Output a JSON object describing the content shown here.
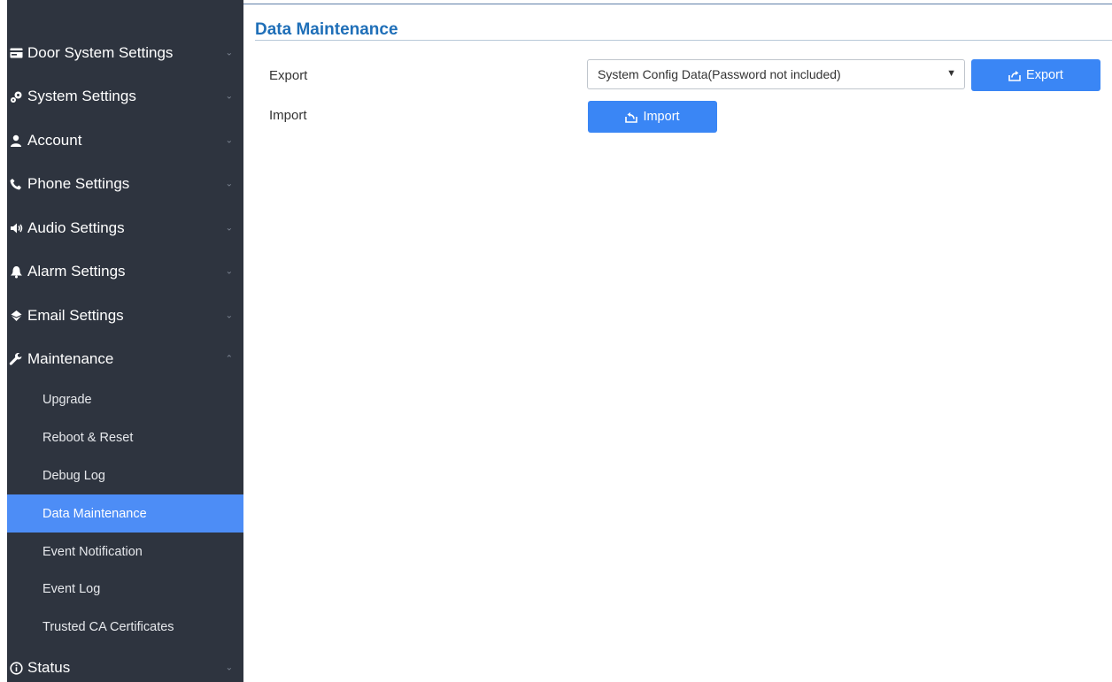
{
  "sidebar": {
    "items": [
      {
        "label": "Door System Settings",
        "icon": "card-icon"
      },
      {
        "label": "System Settings",
        "icon": "gears-icon"
      },
      {
        "label": "Account",
        "icon": "user-icon"
      },
      {
        "label": "Phone Settings",
        "icon": "phone-icon"
      },
      {
        "label": "Audio Settings",
        "icon": "speaker-icon"
      },
      {
        "label": "Alarm Settings",
        "icon": "bell-icon"
      },
      {
        "label": "Email Settings",
        "icon": "email-icon"
      },
      {
        "label": "Maintenance",
        "icon": "wrench-icon",
        "expanded": true
      }
    ],
    "sub_items": [
      {
        "label": "Upgrade"
      },
      {
        "label": "Reboot & Reset"
      },
      {
        "label": "Debug Log"
      },
      {
        "label": "Data Maintenance",
        "active": true
      },
      {
        "label": "Event Notification"
      },
      {
        "label": "Event Log"
      },
      {
        "label": "Trusted CA Certificates"
      }
    ],
    "status": {
      "label": "Status",
      "icon": "info-icon"
    }
  },
  "main": {
    "title": "Data Maintenance",
    "export": {
      "label": "Export",
      "select_value": "System Config Data(Password not included)",
      "button_label": "Export"
    },
    "import": {
      "label": "Import",
      "button_label": "Import"
    }
  },
  "colors": {
    "sidebar_bg": "#2e343f",
    "active_item": "#4d8df6",
    "button": "#3a86f5",
    "title": "#1f6fb8"
  }
}
